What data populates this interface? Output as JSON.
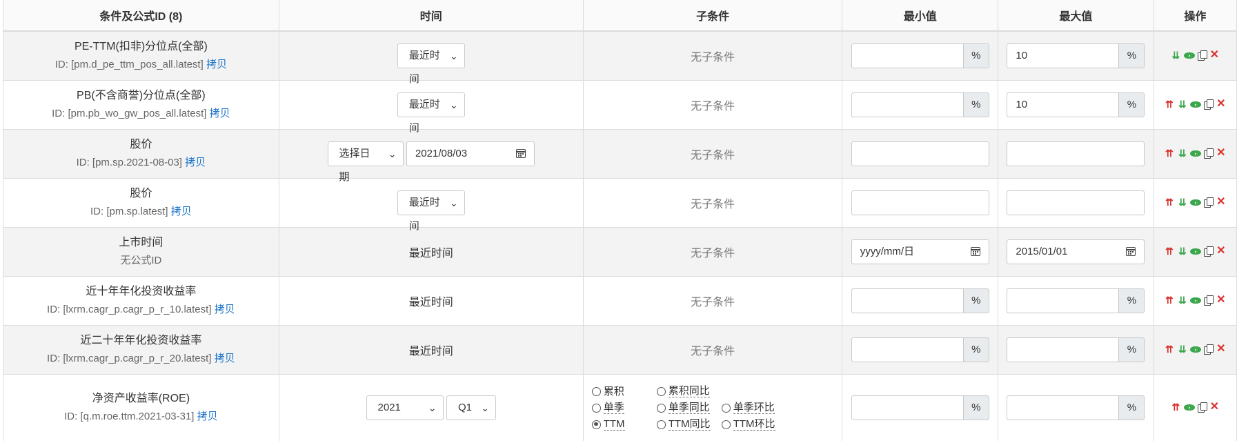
{
  "headers": [
    "条件及公式ID (8)",
    "时间",
    "子条件",
    "最小值",
    "最大值",
    "操作"
  ],
  "copy_label": "拷贝",
  "rows": [
    {
      "name": "PE-TTM(扣非)分位点(全部)",
      "id": "ID: [pm.d_pe_ttm_pos_all.latest]",
      "time": "最近时间",
      "sub": "无子条件",
      "min": "",
      "min_unit": "%",
      "max": "10",
      "max_unit": "%"
    },
    {
      "name": "PB(不含商誉)分位点(全部)",
      "id": "ID: [pm.pb_wo_gw_pos_all.latest]",
      "time": "最近时间",
      "sub": "无子条件",
      "min": "",
      "min_unit": "%",
      "max": "10",
      "max_unit": "%"
    },
    {
      "name": "股价",
      "id": "ID: [pm.sp.2021-08-03]",
      "time": "选择日期",
      "date": "2021/08/03",
      "sub": "无子条件",
      "min": "",
      "max": ""
    },
    {
      "name": "股价",
      "id": "ID: [pm.sp.latest]",
      "time": "最近时间",
      "sub": "无子条件",
      "min": "",
      "max": ""
    },
    {
      "name": "上市时间",
      "id": "无公式ID",
      "time": "最近时间",
      "sub": "无子条件",
      "min": "yyyy/mm/日",
      "max": "2015/01/01"
    },
    {
      "name": "近十年年化投资收益率",
      "id": "ID: [lxrm.cagr_p.cagr_p_r_10.latest]",
      "time": "最近时间",
      "sub": "无子条件",
      "min": "",
      "min_unit": "%",
      "max": "",
      "max_unit": "%"
    },
    {
      "name": "近二十年年化投资收益率",
      "id": "ID: [lxrm.cagr_p.cagr_p_r_20.latest]",
      "time": "最近时间",
      "sub": "无子条件",
      "min": "",
      "min_unit": "%",
      "max": "",
      "max_unit": "%"
    },
    {
      "name": "净资产收益率(ROE)",
      "id": "ID: [q.m.roe.ttm.2021-03-31]",
      "year": "2021",
      "quarter": "Q1",
      "radios": [
        "累积",
        "累积同比",
        "",
        "单季",
        "单季同比",
        "单季环比",
        "TTM",
        "TTM同比",
        "TTM环比"
      ],
      "radio_selected": "TTM",
      "min": "",
      "min_unit": "%",
      "max": "",
      "max_unit": "%"
    }
  ],
  "icons": {
    "move_up": "double-chevron-up-icon",
    "move_down": "double-chevron-down-icon",
    "view": "eye-icon",
    "duplicate": "copy-icon",
    "delete": "close-icon"
  },
  "colors": {
    "link": "#1a73c8",
    "up": "#d9302c",
    "down": "#3aa64a",
    "delete": "#d9302c",
    "row_alt": "#f3f3f3"
  }
}
